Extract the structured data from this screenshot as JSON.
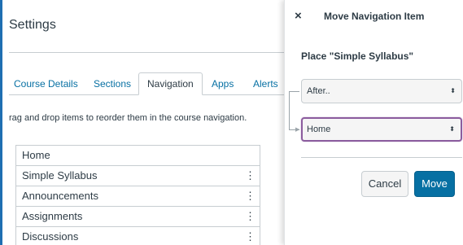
{
  "page": {
    "title": "Settings",
    "instructions": "rag and drop items to reorder them in the course navigation."
  },
  "tabs": [
    {
      "label": "Course Details"
    },
    {
      "label": "Sections"
    },
    {
      "label": "Navigation",
      "active": true
    },
    {
      "label": "Apps"
    },
    {
      "label": "Alerts"
    }
  ],
  "nav_items": [
    {
      "label": "Home",
      "menu": ""
    },
    {
      "label": "Simple Syllabus",
      "menu": "⋮"
    },
    {
      "label": "Announcements",
      "menu": "⋮"
    },
    {
      "label": "Assignments",
      "menu": "⋮"
    },
    {
      "label": "Discussions",
      "menu": "⋮"
    }
  ],
  "tray": {
    "close_glyph": "×",
    "title": "Move Navigation Item",
    "place_label": "Place \"Simple Syllabus\"",
    "position_select": {
      "value": "After..",
      "arrow": "⬍"
    },
    "target_select": {
      "value": "Home",
      "arrow": "⬍"
    },
    "connector_arrow": "▶",
    "cancel_label": "Cancel",
    "move_label": "Move"
  },
  "colors": {
    "link": "#0770a3",
    "primary_button": "#0770a3",
    "focus_ring": "#8b5c9e",
    "border": "#c7cdd1",
    "text": "#2d3b45"
  }
}
